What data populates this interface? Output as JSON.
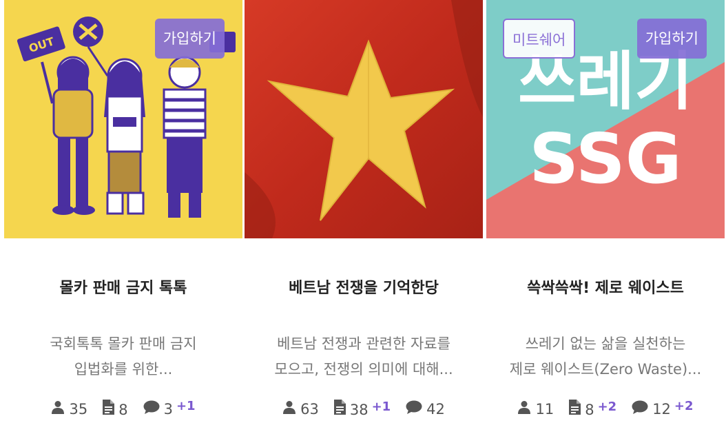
{
  "cards": [
    {
      "title": "몰카 판매 금지 톡톡",
      "desc_line1": "국회톡톡 몰카 판매 금지",
      "desc_line2": "입법화를 위한...",
      "badge_join": "가입하기",
      "image_sign_left": "OUT",
      "members": "35",
      "posts": "8",
      "comments": "3",
      "comments_new": "+1"
    },
    {
      "title": "베트남 전쟁을 기억한당",
      "desc_line1": "베트남 전쟁과 관련한 자료를",
      "desc_line2": "모으고, 전쟁의 의미에 대해...",
      "members": "63",
      "posts": "38",
      "posts_new": "+1",
      "comments": "42"
    },
    {
      "title": "쓱싹쓱싹! 제로 웨이스트",
      "desc_line1": "쓰레기 없는 삶을 실천하는",
      "desc_line2": "제로 웨이스트(Zero Waste)...",
      "badge_meet": "미트쉐어",
      "badge_join": "가입하기",
      "image_text_top": "쓰레기",
      "image_text_bottom": "SSG",
      "members": "11",
      "posts": "8",
      "posts_new": "+2",
      "comments": "12",
      "comments_new": "+2"
    }
  ],
  "colors": {
    "accent": "#7a58cf",
    "yellow": "#f5d64e",
    "flag_red": "#c8301f",
    "flag_star": "#f2c94c",
    "teal": "#7ecdc8",
    "coral": "#e97470"
  },
  "icons": [
    "person-icon",
    "document-icon",
    "comment-icon"
  ]
}
